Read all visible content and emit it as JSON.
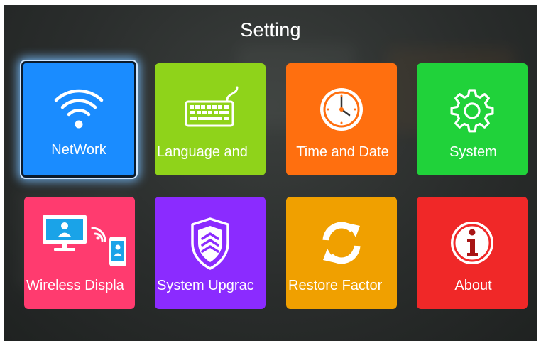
{
  "screen": {
    "title": "Setting"
  },
  "tiles": [
    {
      "label": "NetWork",
      "color": "#1a8cff",
      "icon": "wifi-icon",
      "selected": true
    },
    {
      "label": "Language and",
      "color": "#8fd31a",
      "icon": "keyboard-icon"
    },
    {
      "label": "Time and Date",
      "color": "#ff6f0f",
      "icon": "clock-icon"
    },
    {
      "label": "System",
      "color": "#20d23a",
      "icon": "gear-icon"
    },
    {
      "label": "Wireless Displa",
      "color": "#ff3b6f",
      "icon": "wireless-display-icon"
    },
    {
      "label": "System Upgrac",
      "color": "#8b2bff",
      "icon": "shield-upgrade-icon"
    },
    {
      "label": "Restore Factor",
      "color": "#f0a000",
      "icon": "restore-arrows-icon"
    },
    {
      "label": "About",
      "color": "#f02828",
      "icon": "info-icon"
    }
  ]
}
